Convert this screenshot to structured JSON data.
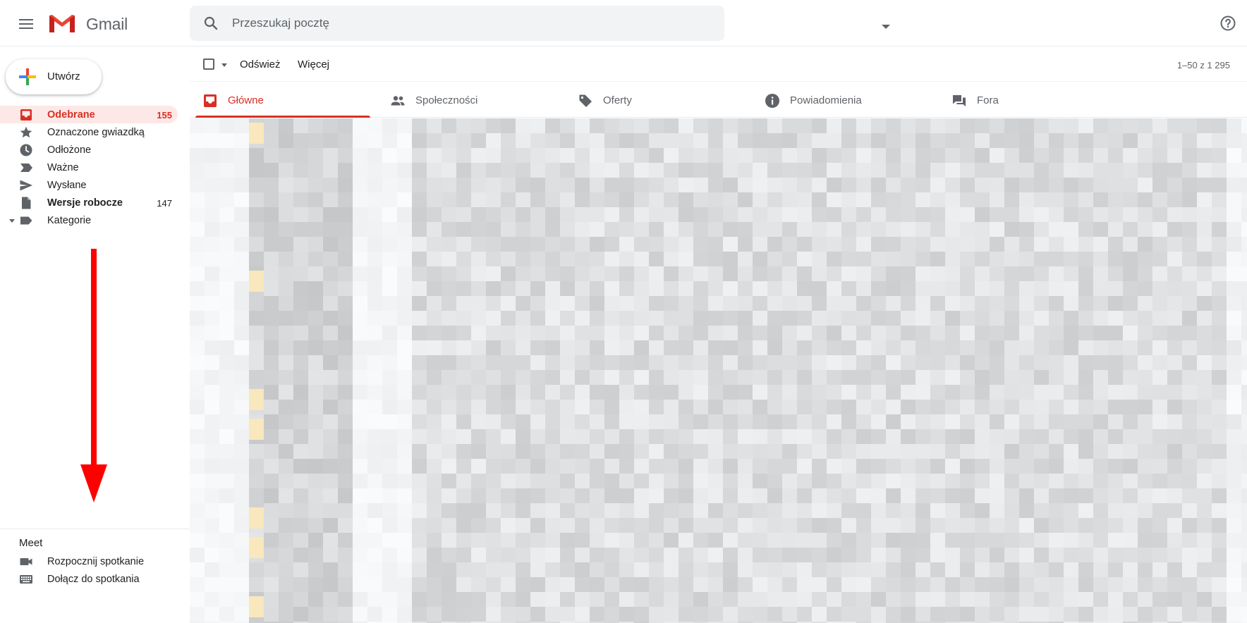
{
  "app": {
    "brand": "Gmail",
    "help_icon": "help-circle-icon"
  },
  "search": {
    "placeholder": "Przeszukaj pocztę"
  },
  "sidebar": {
    "compose_label": "Utwórz",
    "items": [
      {
        "label": "Odebrane",
        "count": "155",
        "icon": "inbox-icon",
        "active": true
      },
      {
        "label": "Oznaczone gwiazdką",
        "count": "",
        "icon": "star-icon"
      },
      {
        "label": "Odłożone",
        "count": "",
        "icon": "clock-icon"
      },
      {
        "label": "Ważne",
        "count": "",
        "icon": "important-icon"
      },
      {
        "label": "Wysłane",
        "count": "",
        "icon": "send-icon"
      },
      {
        "label": "Wersje robocze",
        "count": "147",
        "icon": "draft-icon",
        "bold": true
      },
      {
        "label": "Kategorie",
        "count": "",
        "icon": "label-icon"
      }
    ],
    "meet": {
      "title": "Meet",
      "items": [
        {
          "label": "Rozpocznij spotkanie",
          "icon": "video-icon"
        },
        {
          "label": "Dołącz do spotkania",
          "icon": "keyboard-icon"
        }
      ]
    }
  },
  "toolbar": {
    "refresh_label": "Odśwież",
    "more_label": "Więcej",
    "pager": "1–50 z 1 295"
  },
  "tabs": [
    {
      "label": "Główne",
      "icon": "inbox-icon",
      "active": true
    },
    {
      "label": "Społeczności",
      "icon": "people-icon"
    },
    {
      "label": "Oferty",
      "icon": "tag-icon"
    },
    {
      "label": "Powiadomienia",
      "icon": "info-icon"
    },
    {
      "label": "Fora",
      "icon": "forum-icon"
    }
  ],
  "colors": {
    "accent": "#d93025",
    "active_bg": "#fce8e6",
    "annotation_arrow": "#ff0000"
  }
}
